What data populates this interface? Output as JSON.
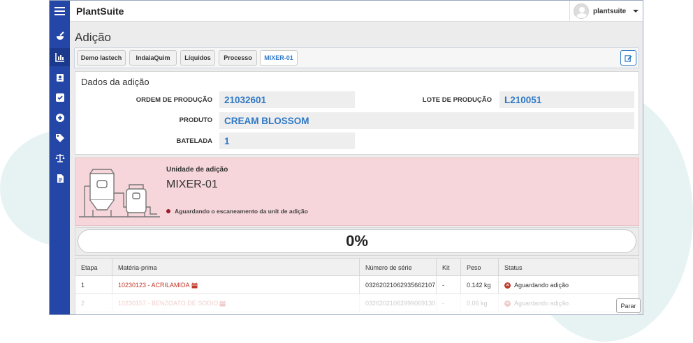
{
  "header": {
    "brand": "PlantSuite",
    "username": "plantsuite"
  },
  "sidebar": {
    "items": [
      {
        "icon": "mortar-pestle-icon"
      },
      {
        "icon": "bar-chart-icon"
      },
      {
        "icon": "clipboard-user-icon"
      },
      {
        "icon": "checkbox-icon"
      },
      {
        "icon": "plus-circle-icon"
      },
      {
        "icon": "tag-icon"
      },
      {
        "icon": "balance-scale-icon"
      },
      {
        "icon": "document-icon"
      }
    ]
  },
  "page": {
    "title": "Adição"
  },
  "breadcrumb": [
    "Demo Iastech",
    "IndaiaQuim",
    "Líquidos",
    "Processo",
    "MIXER-01"
  ],
  "dados": {
    "title": "Dados da adição",
    "ordem_label": "ORDEM DE PRODUÇÃO",
    "ordem_value": "21032601",
    "lote_label": "LOTE DE PRODUÇÃO",
    "lote_value": "L210051",
    "produto_label": "PRODUTO",
    "produto_value": "CREAM BLOSSOM",
    "batelada_label": "BATELADA",
    "batelada_value": "1"
  },
  "unit": {
    "label": "Unidade de adição",
    "name": "MIXER-01",
    "status": "Aguardando o escaneamento da unit de adição"
  },
  "progress": {
    "value": 0,
    "text": "0%"
  },
  "table": {
    "headers": [
      "Etapa",
      "Matéria-prima",
      "Número de série",
      "Kit",
      "Peso",
      "Status"
    ],
    "rows": [
      {
        "etapa": "1",
        "materia": "10230123 - ACRILAMIDA",
        "serie": "03262021062935662107",
        "kit": "-",
        "peso": "0.142 kg",
        "status": "Aguardando adição"
      },
      {
        "etapa": "2",
        "materia": "10230157 - BENZOATO DE SODIO",
        "serie": "03262021062999069130",
        "kit": "-",
        "peso": "0.06 kg",
        "status": "Aguardando adição"
      }
    ]
  },
  "actions": {
    "stop_label": "Parar"
  },
  "colors": {
    "brand": "#2346a7",
    "accent": "#2f78c6",
    "alert_bg": "#f6d6da",
    "error": "#c0392b"
  }
}
